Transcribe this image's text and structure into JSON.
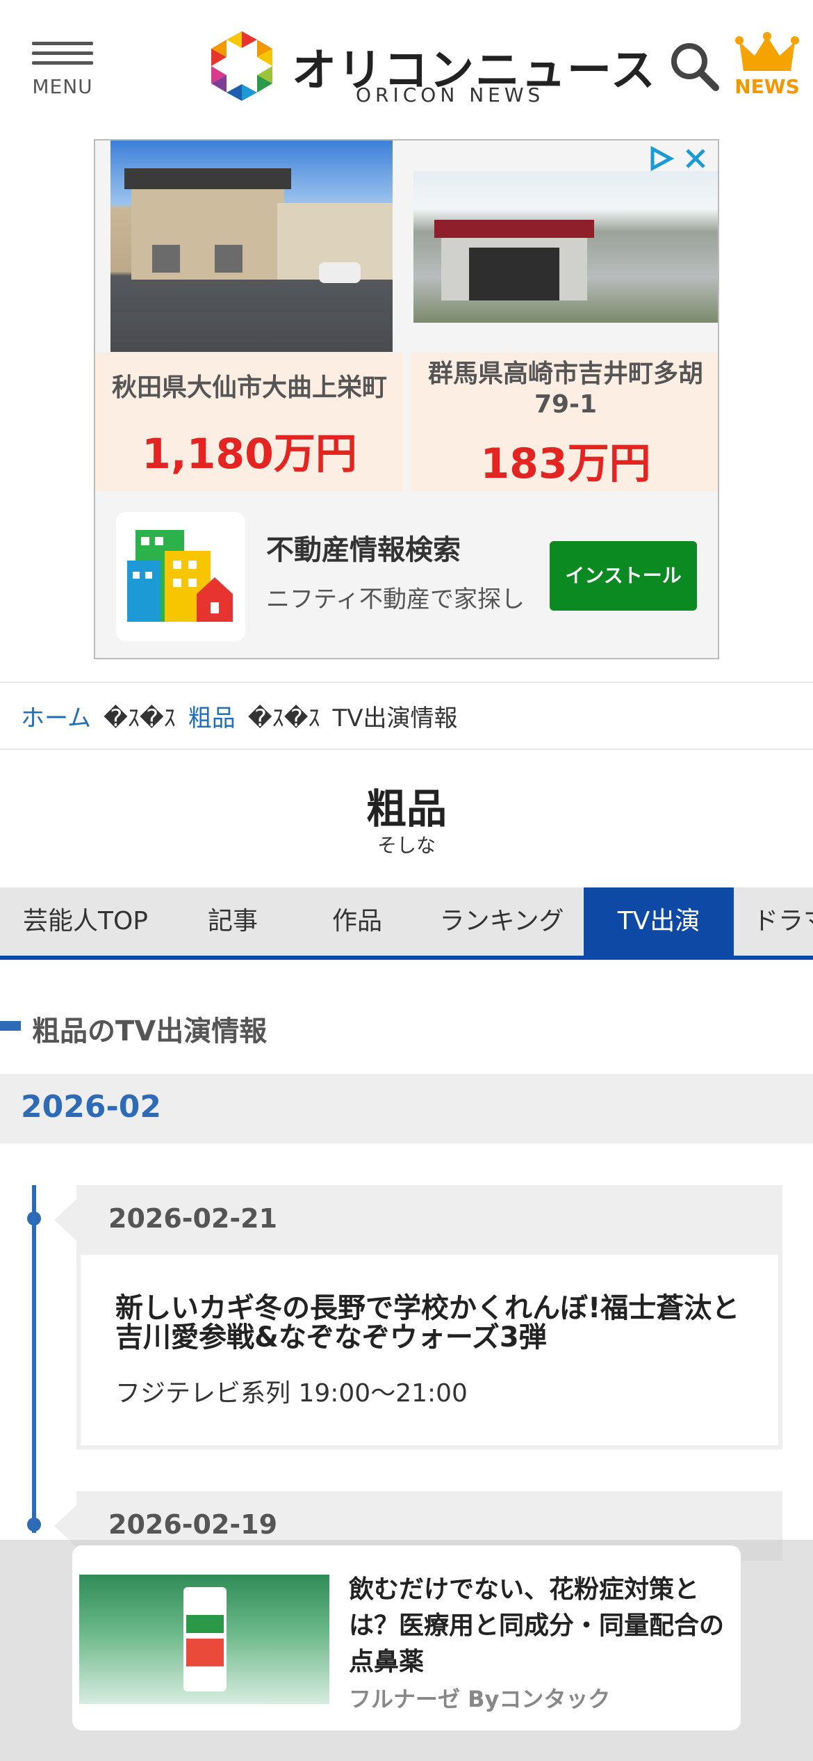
{
  "header": {
    "menu_label": "MENU",
    "logo_jp": "オリコンニュース",
    "logo_en": "ORICON NEWS",
    "news_label": "NEWS"
  },
  "ad": {
    "listing_left": {
      "address": "秋田県大仙市大曲上栄町",
      "price": "1,180万円"
    },
    "listing_right": {
      "address_line1": "群馬県高崎市吉井町多胡",
      "address_line2": "79-1",
      "price": "183万円"
    },
    "app_title": "不動産情報検索",
    "app_subtitle": "ニフティ不動産で家探し",
    "install_label": "インストール"
  },
  "breadcrumb": {
    "home": "ホーム",
    "separator": "�ｽ�ｽ",
    "artist": "粗品",
    "current": "TV出演情報"
  },
  "artist": {
    "name": "粗品",
    "kana": "そしな"
  },
  "tabs": [
    {
      "label": "芸能人TOP",
      "active": false
    },
    {
      "label": "記事",
      "active": false
    },
    {
      "label": "作品",
      "active": false
    },
    {
      "label": "ランキング",
      "active": false
    },
    {
      "label": "TV出演",
      "active": true
    },
    {
      "label": "ドラマ",
      "active": false
    }
  ],
  "section": {
    "heading": "粗品のTV出演情報"
  },
  "month": "2026-02",
  "entries": [
    {
      "date": "2026-02-21",
      "title": "新しいカギ冬の長野で学校かくれんぼ!福士蒼汰と吉川愛参戦&なぞなぞウォーズ3弾",
      "info": "フジテレビ系列 19:00〜21:00"
    },
    {
      "date": "2026-02-19"
    }
  ],
  "floating_ad": {
    "title": "飲むだけでない、花粉症対策とは？医療用と同成分・同量配合の点鼻薬",
    "brand": "フルナーゼ Byコンタック"
  },
  "colors": {
    "accent_blue": "#0e4aa5",
    "link_blue": "#1f6fb8",
    "timeline_blue": "#2e6bb6",
    "news_orange": "#f39800",
    "price_red": "#e32420",
    "install_green": "#0b8a22"
  },
  "icons": [
    "hamburger-menu-icon",
    "oricon-logo-icon",
    "search-icon",
    "crown-icon",
    "adchoices-icon",
    "close-icon",
    "building-app-icon"
  ]
}
